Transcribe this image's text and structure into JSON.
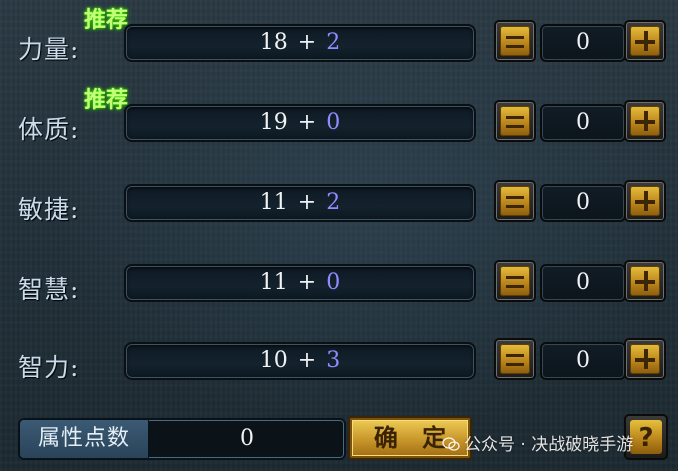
{
  "attributes": [
    {
      "label": "力量:",
      "base": "18",
      "bonus": "2",
      "recommended": true,
      "allocated": "0"
    },
    {
      "label": "体质:",
      "base": "19",
      "bonus": "0",
      "recommended": true,
      "allocated": "0"
    },
    {
      "label": "敏捷:",
      "base": "11",
      "bonus": "2",
      "recommended": false,
      "allocated": "0"
    },
    {
      "label": "智慧:",
      "base": "11",
      "bonus": "0",
      "recommended": false,
      "allocated": "0"
    },
    {
      "label": "智力:",
      "base": "10",
      "bonus": "3",
      "recommended": false,
      "allocated": "0"
    }
  ],
  "recommend_label": "推荐",
  "plus_sign": "+",
  "points": {
    "label": "属性点数",
    "value": "0"
  },
  "confirm_label": "确 定",
  "help_label": "?",
  "watermark": "公众号 · 决战破晓手游",
  "icons": {
    "minus": "minus-icon",
    "plus": "plus-icon",
    "help": "question-icon",
    "watermark": "wechat-icon"
  },
  "colors": {
    "bonus": "#8f8cff",
    "recommend": "#c6ff7a",
    "button_gold": "#d4a032"
  }
}
